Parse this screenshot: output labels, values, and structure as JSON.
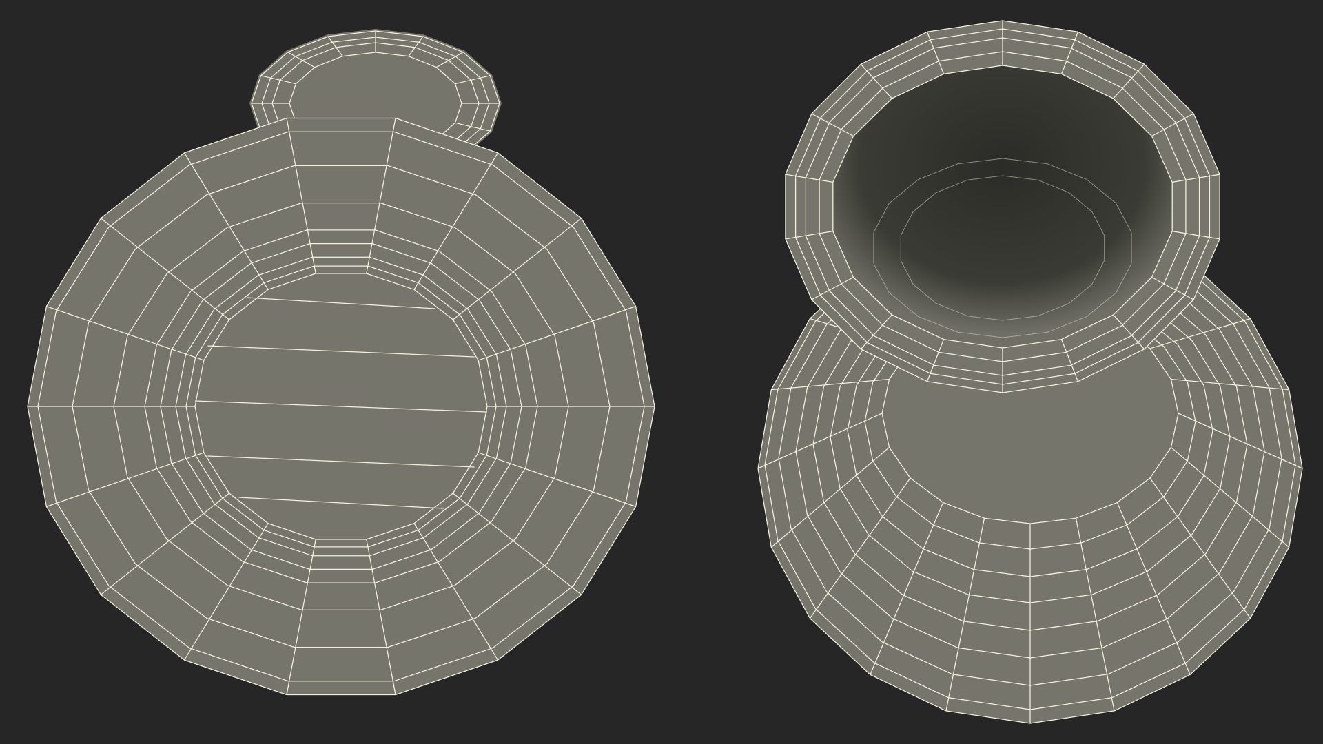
{
  "scene": {
    "background_color": "#262626",
    "mesh_fill_color": "#75756c",
    "wire_color": "#f4f1df",
    "inner_shadow_color": "#30312b",
    "objects": [
      {
        "name": "vase-bottom-view",
        "view": "bottom"
      },
      {
        "name": "vase-top-view",
        "view": "top-perspective"
      }
    ]
  }
}
